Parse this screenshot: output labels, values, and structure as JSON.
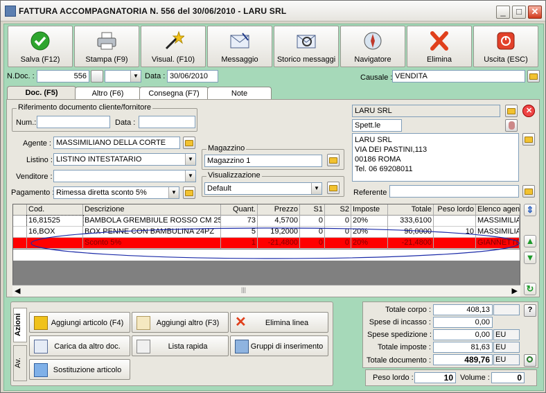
{
  "window": {
    "title": "FATTURA ACCOMPAGNATORIA N. 556  del 30/06/2010 - LARU SRL"
  },
  "toolbar": [
    {
      "label": "Salva (F12)",
      "icon": "checkmark-icon"
    },
    {
      "label": "Stampa (F9)",
      "icon": "printer-icon"
    },
    {
      "label": "Visual. (F10)",
      "icon": "magic-wand-icon"
    },
    {
      "label": "Messaggio",
      "icon": "envelope-icon"
    },
    {
      "label": "Storico messaggi",
      "icon": "envelope-search-icon"
    },
    {
      "label": "Navigatore",
      "icon": "compass-icon"
    },
    {
      "label": "Elimina",
      "icon": "delete-x-icon"
    },
    {
      "label": "Uscita (ESC)",
      "icon": "exit-icon"
    }
  ],
  "header": {
    "ndoc_label": "N.Doc. :",
    "ndoc_value": "556",
    "data_label": "Data :",
    "data_value": "30/06/2010",
    "causale_label": "Causale :",
    "causale_value": "VENDITA"
  },
  "tabs": [
    {
      "label": "Doc. (F5)"
    },
    {
      "label": "Altro (F6)"
    },
    {
      "label": "Consegna (F7)"
    },
    {
      "label": "Note"
    }
  ],
  "riferimento": {
    "caption": "Riferimento documento cliente/fornitore",
    "num_label": "Num.:",
    "num_value": "",
    "data_label": "Data :",
    "data_value": ""
  },
  "agente": {
    "label": "Agente :",
    "value": "MASSIMILIANO DELLA CORTE"
  },
  "listino": {
    "label": "Listino :",
    "value": "LISTINO INTESTATARIO"
  },
  "venditore": {
    "label": "Venditore :",
    "value": ""
  },
  "pagamento": {
    "label": "Pagamento :",
    "value": "Rimessa diretta sconto 5%"
  },
  "magazzino": {
    "caption": "Magazzino",
    "value": "Magazzino 1"
  },
  "visualizzazione": {
    "caption": "Visualizzazione",
    "value": "Default"
  },
  "cliente": {
    "name": "LARU SRL",
    "spett": "Spett.le",
    "address": [
      "LARU SRL",
      "VIA DEI PASTINI,113",
      "00186 ROMA",
      "Tel. 06 69208011"
    ],
    "referente_label": "Referente",
    "referente_value": ""
  },
  "grid": {
    "columns": [
      "Cod.",
      "Descrizione",
      "Quant.",
      "Prezzo",
      "S1",
      "S2",
      "Imposte",
      "Totale",
      "Peso lordo",
      "Elenco agen"
    ],
    "rows": [
      [
        "16,81525",
        "BAMBOLA GREMBIULE ROSSO CM 25",
        "73",
        "4,5700",
        "0",
        "0",
        "20%",
        "333,6100",
        "",
        "MASSIMILIA"
      ],
      [
        "16,BOX",
        "BOX PENNE CON BAMBULINA 24PZ",
        "5",
        "19,2000",
        "0",
        "0",
        "20%",
        "96,0000",
        "10",
        "MASSIMILIA"
      ],
      [
        "",
        "Sconto 5%",
        "1",
        "-21,4800",
        "0",
        "0",
        "20%",
        "-21,4800",
        "",
        "GIANNETTE"
      ]
    ]
  },
  "actions": {
    "side_tabs": [
      "Azioni",
      "Av."
    ],
    "buttons": [
      "Aggiungi articolo (F4)",
      "Aggiungi altro (F3)",
      "Elimina linea",
      "Carica da altro doc.",
      "Lista rapida",
      "Gruppi di inserimento",
      "Sostituzione articolo"
    ]
  },
  "totals": {
    "totale_corpo_label": "Totale corpo :",
    "totale_corpo": "408,13",
    "help": "?",
    "spese_incasso_label": "Spese di incasso :",
    "spese_incasso": "0,00",
    "spese_spedizione_label": "Spese spedizione :",
    "spese_spedizione": "0,00",
    "spese_spedizione_unit": "EU",
    "totale_imposte_label": "Totale imposte :",
    "totale_imposte": "81,63",
    "totale_imposte_unit": "EU",
    "totale_documento_label": "Totale documento :",
    "totale_documento": "489,76",
    "totale_documento_unit": "EU"
  },
  "pesi": {
    "peso_lordo_label": "Peso lordo :",
    "peso_lordo": "10",
    "volume_label": "Volume :",
    "volume": "0"
  },
  "colors": {
    "accent_green": "#a6d9b9",
    "row_highlight": "#ff0000",
    "ellipse": "#1a2aa8"
  }
}
